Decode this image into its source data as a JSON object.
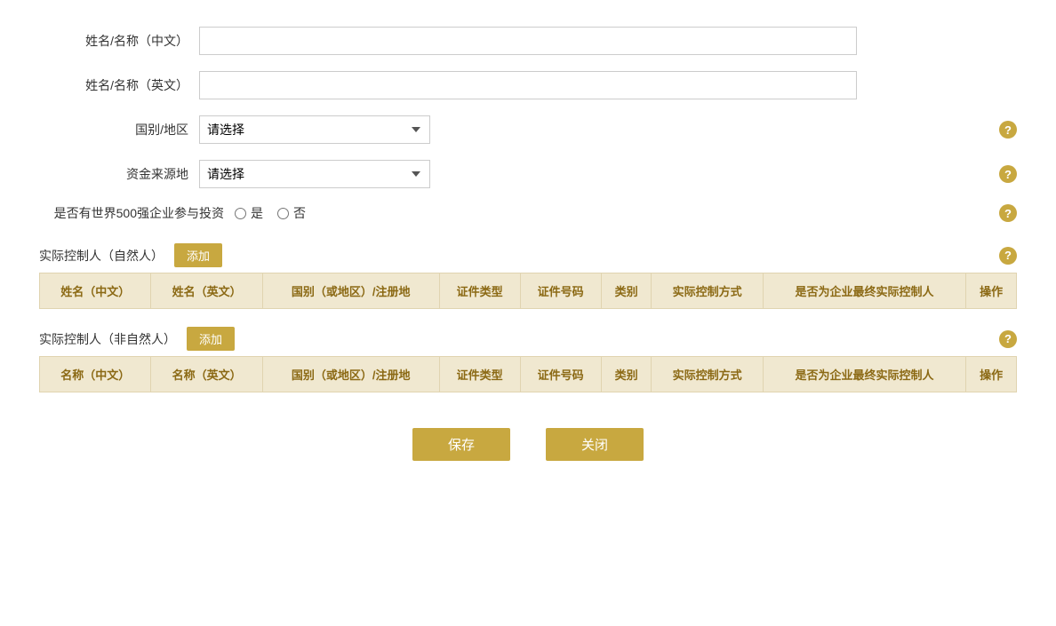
{
  "form": {
    "name_cn_label": "姓名/名称（中文）",
    "name_en_label": "姓名/名称（英文）",
    "country_label": "国别/地区",
    "country_placeholder": "请选择",
    "fund_source_label": "资金来源地",
    "fund_source_placeholder": "请选择",
    "fortune500_label": "是否有世界500强企业参与投资",
    "yes_label": "是",
    "no_label": "否"
  },
  "section1": {
    "title": "实际控制人（自然人）",
    "add_label": "添加",
    "columns": [
      "姓名（中文）",
      "姓名（英文）",
      "国别（或地区）/注册地",
      "证件类型",
      "证件号码",
      "类别",
      "实际控制方式",
      "是否为企业最终实际控制人",
      "操作"
    ]
  },
  "section2": {
    "title": "实际控制人（非自然人）",
    "add_label": "添加",
    "columns": [
      "名称（中文）",
      "名称（英文）",
      "国别（或地区）/注册地",
      "证件类型",
      "证件号码",
      "类别",
      "实际控制方式",
      "是否为企业最终实际控制人",
      "操作"
    ]
  },
  "buttons": {
    "save": "保存",
    "close": "关闭"
  },
  "help_icon_text": "?",
  "colors": {
    "gold": "#c8a840",
    "table_header_bg": "#f0e8d0",
    "table_header_text": "#8b6914"
  }
}
